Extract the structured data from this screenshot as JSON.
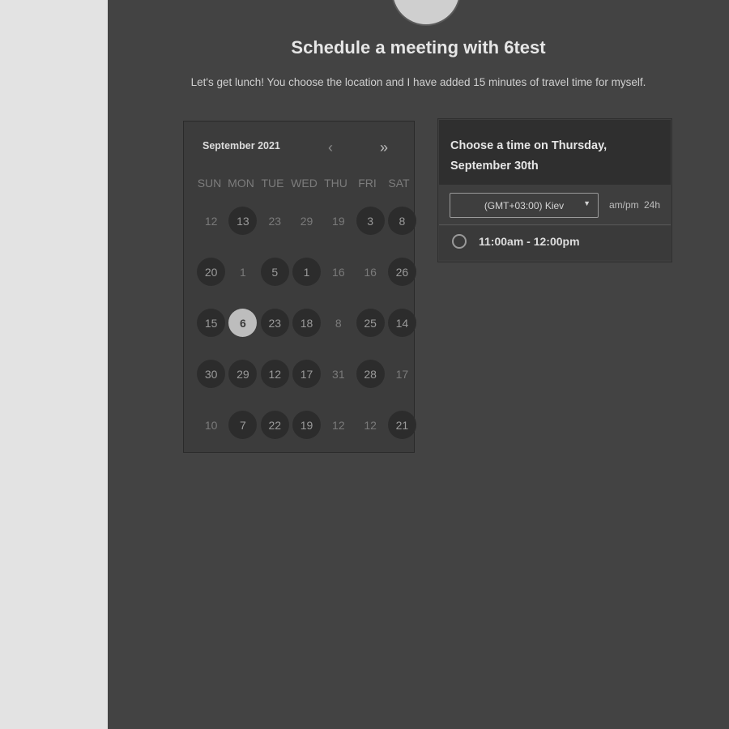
{
  "header": {
    "title": "Schedule a meeting with 6test",
    "subtitle": "Let's get lunch! You choose the location and I have added 15 minutes of travel time for myself."
  },
  "calendar": {
    "month_label": "September 2021",
    "prev_icon": "‹",
    "next_icon": "»",
    "weekdays": [
      "SUN",
      "MON",
      "TUE",
      "WED",
      "THU",
      "FRI",
      "SAT"
    ],
    "days": [
      {
        "label": "12",
        "state": "plain"
      },
      {
        "label": "13",
        "state": "available"
      },
      {
        "label": "23",
        "state": "plain"
      },
      {
        "label": "29",
        "state": "plain"
      },
      {
        "label": "19",
        "state": "plain"
      },
      {
        "label": "3",
        "state": "available"
      },
      {
        "label": "8",
        "state": "available"
      },
      {
        "label": "20",
        "state": "available"
      },
      {
        "label": "1",
        "state": "plain"
      },
      {
        "label": "5",
        "state": "available"
      },
      {
        "label": "1",
        "state": "available"
      },
      {
        "label": "16",
        "state": "plain"
      },
      {
        "label": "16",
        "state": "plain"
      },
      {
        "label": "26",
        "state": "available"
      },
      {
        "label": "15",
        "state": "available"
      },
      {
        "label": "6",
        "state": "selected"
      },
      {
        "label": "23",
        "state": "available"
      },
      {
        "label": "18",
        "state": "available"
      },
      {
        "label": "8",
        "state": "plain"
      },
      {
        "label": "25",
        "state": "available"
      },
      {
        "label": "14",
        "state": "available"
      },
      {
        "label": "30",
        "state": "available"
      },
      {
        "label": "29",
        "state": "available"
      },
      {
        "label": "12",
        "state": "available"
      },
      {
        "label": "17",
        "state": "available"
      },
      {
        "label": "31",
        "state": "plain"
      },
      {
        "label": "28",
        "state": "available"
      },
      {
        "label": "17",
        "state": "plain"
      },
      {
        "label": "10",
        "state": "plain"
      },
      {
        "label": "7",
        "state": "available"
      },
      {
        "label": "22",
        "state": "available"
      },
      {
        "label": "19",
        "state": "available"
      },
      {
        "label": "12",
        "state": "plain"
      },
      {
        "label": "12",
        "state": "plain"
      },
      {
        "label": "21",
        "state": "available"
      }
    ]
  },
  "time_panel": {
    "heading": "Choose a time on Thursday, September 30th",
    "timezone": "(GMT+03:00) Kiev",
    "format_ampm": "am/pm",
    "format_24h": "24h",
    "slots": [
      {
        "label": "11:00am - 12:00pm"
      }
    ]
  },
  "colors": {
    "main_bg": "#434343",
    "side_bg": "#e3e3e3",
    "selected_day": "#bdbdbd"
  }
}
